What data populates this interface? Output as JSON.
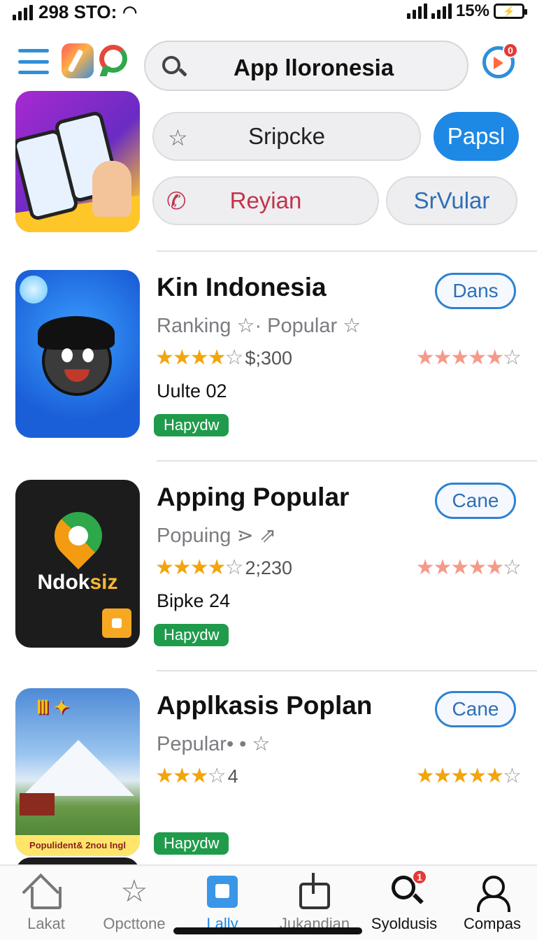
{
  "status_bar": {
    "left_text": "298 STO:",
    "battery_percent": "15%"
  },
  "search": {
    "value": "App lloronesia"
  },
  "notification": {
    "count": "0"
  },
  "promo_chips": [
    {
      "label": "Sripcke"
    },
    {
      "label": "Papsl",
      "active": true
    },
    {
      "label": "Reyian"
    },
    {
      "label": "SrVular"
    }
  ],
  "apps": [
    {
      "title": "Kin Indonesia",
      "subtitle": "Ranking ☆· Popular ☆",
      "stars": "★★★★",
      "half": "☆",
      "price": "$;300",
      "stars_right": "★★★★★",
      "stars_right_empty": "☆",
      "meta": "Uulte 02",
      "tag": "Hapydw",
      "button": "Dans"
    },
    {
      "title": "Apping Popular",
      "subtitle": "Popuing ⋗ ⇗",
      "stars": "★★★★",
      "half": "☆",
      "price": "2;230",
      "stars_right": "★★★★★",
      "stars_right_empty": "☆",
      "meta": "Bipke 24",
      "tag": "Hapydw",
      "button": "Cane",
      "image_text_a": "Ndok",
      "image_text_b": "siz"
    },
    {
      "title": "Applkasis Poplan",
      "subtitle": "Pepular• • ☆",
      "stars": "★★★",
      "half": "☆",
      "price": "4",
      "stars_right": "★★★★★",
      "stars_right_empty": "☆",
      "meta": "",
      "tag": "Hapydw",
      "button": "Cane",
      "image_caption": "Populident& 2nou Ingl"
    }
  ],
  "bottom_nav": [
    {
      "label": "Lakat",
      "icon": "home-icon"
    },
    {
      "label": "Opcttone",
      "icon": "star-icon"
    },
    {
      "label": "Lally",
      "icon": "book-icon",
      "active": true
    },
    {
      "label": "Jukandian",
      "icon": "pull-icon"
    },
    {
      "label": "Syoldusis",
      "icon": "search-icon",
      "badge": "1"
    },
    {
      "label": "Compas",
      "icon": "user-icon"
    }
  ],
  "colors": {
    "accent": "#1e88e5",
    "tag": "#1f9b4b",
    "star": "#f2a50c"
  }
}
